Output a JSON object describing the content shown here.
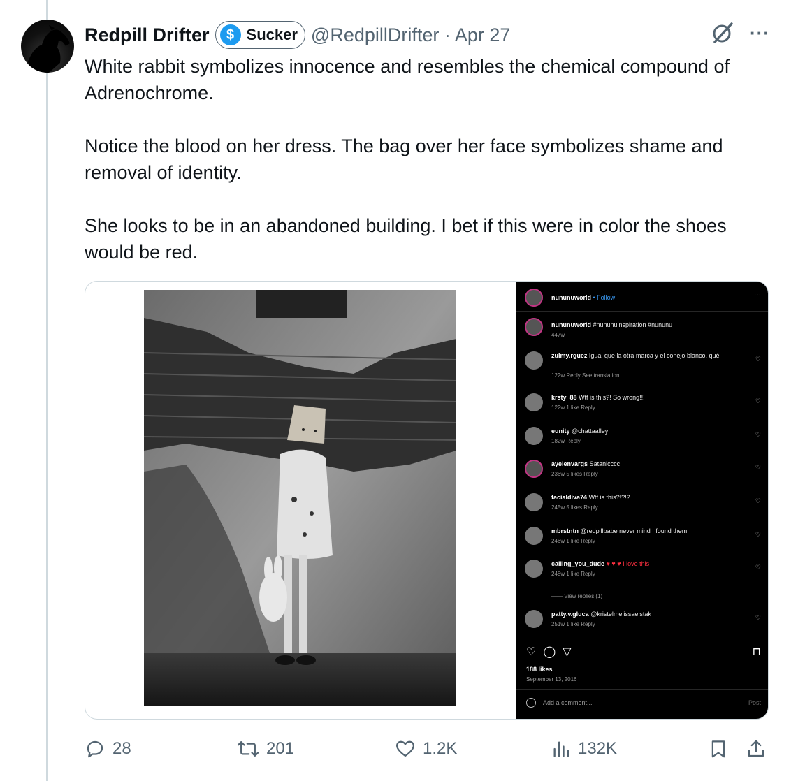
{
  "author": {
    "name": "Redpill Drifter",
    "badge_label": "Sucker",
    "badge_symbol": "$",
    "handle_line": "@RedpillDrifter · Apr 27"
  },
  "tweet": {
    "paragraphs": [
      "White rabbit symbolizes innocence and resembles the chemical compound of Adrenochrome.",
      "Notice the blood on her dress. The bag over her face symbolizes shame and removal of identity.",
      "She looks to be in an abandoned building. I bet if this were in color the shoes would be red."
    ]
  },
  "top_actions": {
    "grok_icon": "grok-slash-icon",
    "more_icon": "more-horizontal-icon",
    "more_text": "···"
  },
  "instagram": {
    "header_user": "nununuworld",
    "header_follow": "• Follow",
    "header_dots": "···",
    "caption_user": "nununuworld",
    "caption_text": "#nununuinspiration #nununu",
    "caption_age": "447w",
    "comments": [
      {
        "user": "zulmy.rguez",
        "text": "Igual que la otra marca y el conejo blanco, qué",
        "meta": "122w   Reply   See translation"
      },
      {
        "user": "krsty_88",
        "text": "Wtf is this?! So wrong!!!",
        "meta": "122w   1 like   Reply"
      },
      {
        "user": "eunity",
        "text": "@chattaalley",
        "meta": "182w   Reply"
      },
      {
        "user": "ayelenvargs",
        "text": "Satanicccc",
        "meta": "236w   5 likes   Reply"
      },
      {
        "user": "facialdiva74",
        "text": "Wtf is this?!?!?",
        "meta": "245w   5 likes   Reply"
      },
      {
        "user": "mbrstntn",
        "text": "@redpillbabe never mind I found them",
        "meta": "246w   1 like   Reply"
      },
      {
        "user": "calling_you_dude",
        "text": "♥ ♥ ♥  I love this",
        "meta": "248w   1 like   Reply"
      },
      {
        "user": "patty.v.gluca",
        "text": "@kristelmelissaelstak",
        "meta": "251w   1 like   Reply"
      }
    ],
    "view_replies": "——   View replies (1)",
    "likes": "188 likes",
    "date": "September 13, 2016",
    "add_comment": "Add a comment...",
    "post": "Post"
  },
  "stats": {
    "replies": "28",
    "reposts": "201",
    "likes": "1.2K",
    "views": "132K"
  },
  "colors": {
    "text": "#0f1419",
    "secondary": "#536471",
    "brand": "#1d9bf0",
    "border": "#cfd9de"
  }
}
